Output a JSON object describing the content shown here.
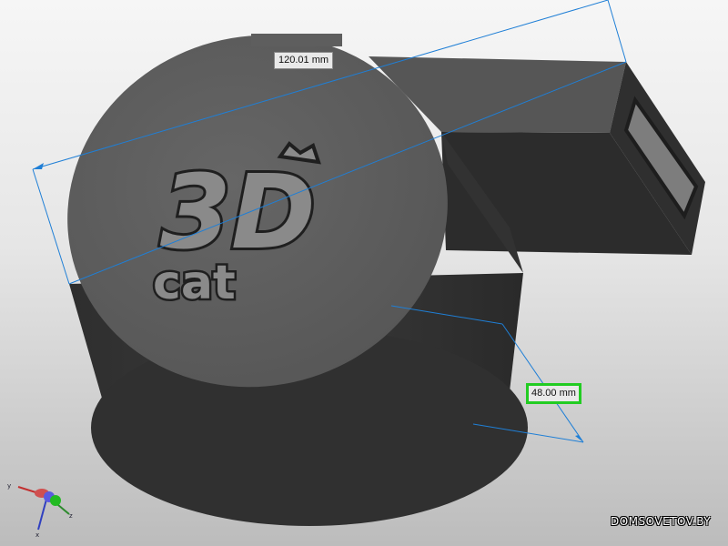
{
  "measurements": {
    "length": "120.01 mm",
    "diameter": "48.00 mm"
  },
  "model": {
    "engraving_line1": "3D",
    "engraving_line2": "cat",
    "body_color": "#3f3f3f"
  },
  "axes": {
    "x": "x",
    "y": "y",
    "z": "z"
  },
  "watermark": "DOMSOVETOV.BY",
  "colors": {
    "dimension_line": "#1f7fd6",
    "selected_highlight": "#22cc22"
  }
}
